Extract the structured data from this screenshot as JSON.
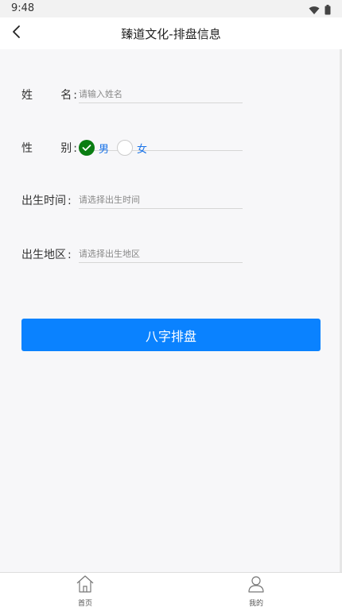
{
  "status_bar": {
    "time": "9:48"
  },
  "nav": {
    "title": "臻道文化-排盘信息",
    "back_icon": "chevron-left-icon"
  },
  "form": {
    "name": {
      "label_first": "姓",
      "label_last": "名",
      "colon": ":",
      "placeholder": "请输入姓名"
    },
    "gender": {
      "label_first": "性",
      "label_last": "别",
      "colon": ":",
      "options": [
        {
          "label": "男",
          "checked": true
        },
        {
          "label": "女",
          "checked": false
        }
      ]
    },
    "birth_time": {
      "label": "出生时间",
      "colon": ":",
      "placeholder": "请选择出生时间"
    },
    "birth_region": {
      "label": "出生地区",
      "colon": ":",
      "placeholder": "请选择出生地区"
    }
  },
  "submit": {
    "label": "八字排盘"
  },
  "tabbar": {
    "items": [
      {
        "label": "首页",
        "icon": "home-icon"
      },
      {
        "label": "我的",
        "icon": "user-icon"
      }
    ]
  },
  "colors": {
    "primary": "#0a82ff",
    "checked": "#0a7d12",
    "radio_text": "#1a73e8"
  }
}
